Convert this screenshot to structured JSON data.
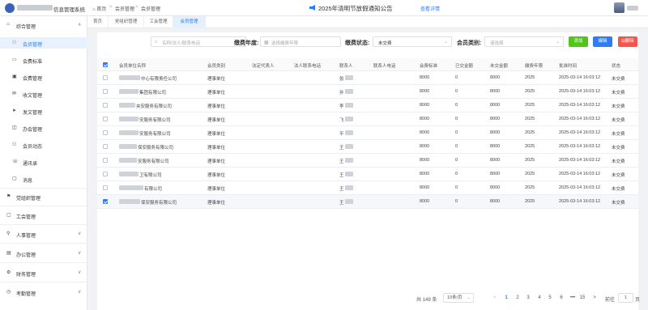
{
  "header": {
    "app_title": "信息管理系统",
    "breadcrumb": [
      "首页",
      "会员管理",
      "会员管理"
    ],
    "notice": "2025年清明节放假通知公告",
    "detail_link": "查看详情"
  },
  "tabs": [
    {
      "label": "首页"
    },
    {
      "label": "党组织管理"
    },
    {
      "label": "工会管理"
    },
    {
      "label": "会员管理",
      "active": true
    }
  ],
  "sidebar": {
    "items": [
      {
        "label": "综合管理",
        "icon": "home-icon",
        "chevron": "∧"
      },
      {
        "label": "会员管理",
        "icon": "users-icon"
      },
      {
        "label": "会费标准",
        "icon": "card-icon"
      },
      {
        "label": "会费管理",
        "icon": "money-icon"
      },
      {
        "label": "收文管理",
        "icon": "inbox-icon"
      },
      {
        "label": "发文管理",
        "icon": "send-icon"
      },
      {
        "label": "办会管理",
        "icon": "meeting-icon"
      },
      {
        "label": "会员动态",
        "icon": "activity-icon"
      },
      {
        "label": "通讯录",
        "icon": "contacts-icon"
      },
      {
        "label": "消息",
        "icon": "message-icon"
      },
      {
        "label": "党组织管理",
        "icon": "flag-icon"
      },
      {
        "label": "工会管理",
        "icon": "union-icon"
      },
      {
        "label": "人事管理",
        "icon": "person-icon",
        "chevron": "∨"
      },
      {
        "label": "办公管理",
        "icon": "briefcase-icon",
        "chevron": "∨"
      },
      {
        "label": "财务管理",
        "icon": "finance-icon",
        "chevron": "∨"
      },
      {
        "label": "考勤管理",
        "icon": "clock-icon",
        "chevron": "∨"
      }
    ]
  },
  "filters": {
    "search_placeholder": "名称/法人/联系电话",
    "year_label": "缴费年度:",
    "year_placeholder": "选择缴费年限",
    "status_label": "缴费状态:",
    "status_value": "未交费",
    "type_label": "会员类别:",
    "type_placeholder": "请选择"
  },
  "toolbar": {
    "add": "添加",
    "edit": "编辑",
    "delete": "删除"
  },
  "table": {
    "columns": [
      "会员单位名称",
      "会员类别",
      "法定代表人",
      "法人联系电话",
      "联系人",
      "联系人电话",
      "会费标准",
      "已交金额",
      "未交金额",
      "缴费年限",
      "批准时间",
      "状态"
    ],
    "rows": [
      {
        "name": "中心有限责任公司",
        "type": "理事单位",
        "contact": "张",
        "standard": "8000",
        "paid": "0",
        "unpaid": "8000",
        "year": "2025",
        "time": "2025-03-14 16:03:12",
        "status": "未交费"
      },
      {
        "name": "集团有限公司",
        "type": "理事单位",
        "contact": "孙",
        "standard": "8000",
        "paid": "0",
        "unpaid": "8000",
        "year": "2025",
        "time": "2025-03-14 16:03:12",
        "status": "未交费"
      },
      {
        "name": "央安服务有限公司",
        "type": "理事单位",
        "contact": "李",
        "standard": "8000",
        "paid": "0",
        "unpaid": "8000",
        "year": "2025",
        "time": "2025-03-14 16:03:12",
        "status": "未交费"
      },
      {
        "name": "安服务有限公司",
        "type": "理事单位",
        "contact": "飞",
        "standard": "8000",
        "paid": "0",
        "unpaid": "8000",
        "year": "2025",
        "time": "2025-03-14 16:03:12",
        "status": "未交费"
      },
      {
        "name": "安服务有限公司",
        "type": "理事单位",
        "contact": "平",
        "standard": "8000",
        "paid": "0",
        "unpaid": "8000",
        "year": "2025",
        "time": "2025-03-14 16:03:12",
        "status": "未交费"
      },
      {
        "name": "保安服务有限公司",
        "type": "理事单位",
        "contact": "王",
        "standard": "8000",
        "paid": "0",
        "unpaid": "8000",
        "year": "2025",
        "time": "2025-03-14 16:03:12",
        "status": "未交费"
      },
      {
        "name": "安服务有限公司",
        "type": "理事单位",
        "contact": "王",
        "standard": "8000",
        "paid": "0",
        "unpaid": "8000",
        "year": "2025",
        "time": "2025-03-14 16:03:12",
        "status": "未交费"
      },
      {
        "name": "卫有限公司",
        "type": "理事单位",
        "contact": "王",
        "standard": "8000",
        "paid": "0",
        "unpaid": "8000",
        "year": "2025",
        "time": "2025-03-14 16:03:12",
        "status": "未交费"
      },
      {
        "name": "有限公司",
        "type": "理事单位",
        "contact": "王",
        "standard": "8000",
        "paid": "0",
        "unpaid": "8000",
        "year": "2025",
        "time": "2025-03-14 16:03:12",
        "status": "未交费"
      },
      {
        "name": "保安服务有限公司",
        "type": "理事单位",
        "contact": "王",
        "standard": "8000",
        "paid": "0",
        "unpaid": "8000",
        "year": "2025",
        "time": "2025-03-14 16:03:12",
        "status": "未交费",
        "selected": true
      }
    ]
  },
  "pagination": {
    "total": "共 149 条",
    "page_size": "10条/页",
    "pages": [
      "1",
      "2",
      "3",
      "4",
      "5",
      "6",
      "•••",
      "15"
    ],
    "prev": "<",
    "next": ">",
    "goto_label": "前往",
    "goto_value": "1",
    "page_suffix": "页"
  },
  "colors": {
    "primary": "#2f7cf6",
    "add": "#52c41a",
    "delete": "#f5554a"
  }
}
